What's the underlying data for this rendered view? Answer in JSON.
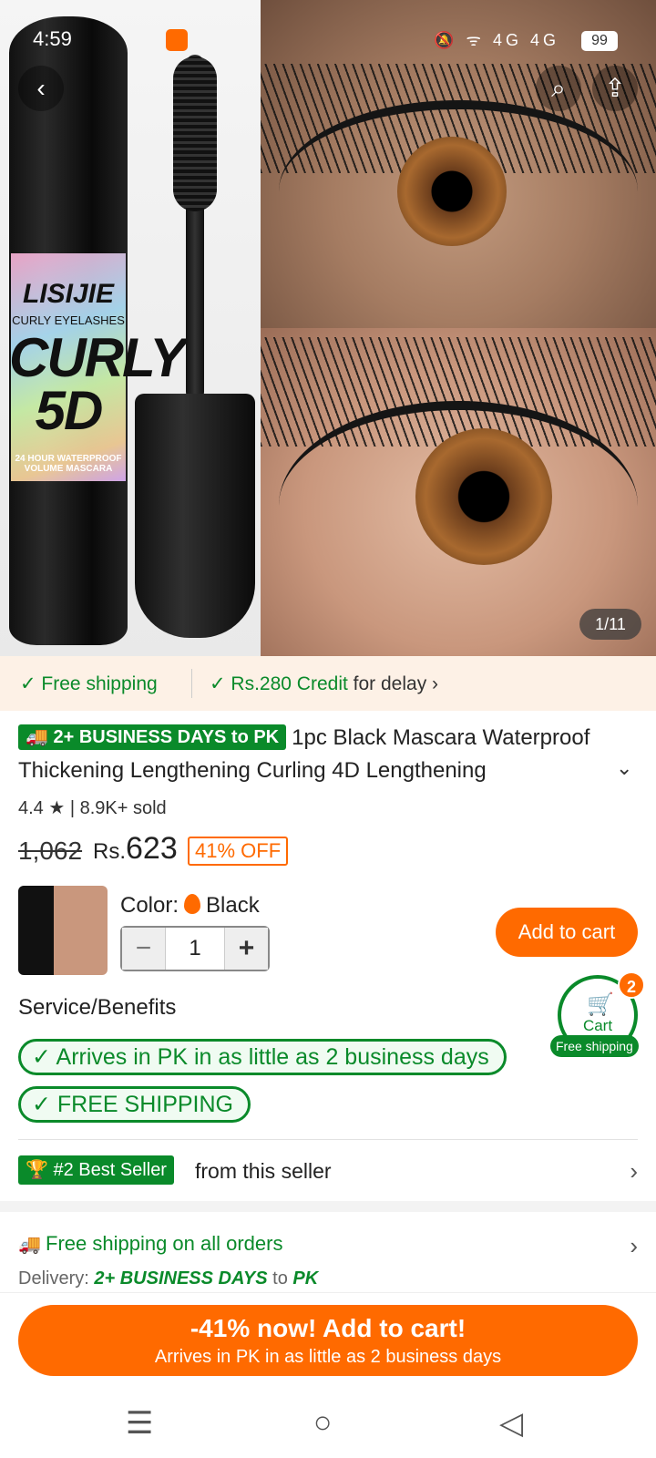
{
  "status_bar": {
    "time": "4:59",
    "icons": "🔕 ᯤ 4G 4G",
    "battery": "99"
  },
  "hero": {
    "tube_brand": "LISIJIE",
    "tube_sub": "CURLY EYELASHES",
    "tube_big": "CURLY 5D",
    "tube_small": "24 HOUR WATERPROOF VOLUME MASCARA",
    "pager": "1/11"
  },
  "nav": {
    "back": "‹",
    "search": "⌕",
    "share": "⇪"
  },
  "ship_strip": {
    "free_shipping": "✓ Free shipping",
    "credit": "✓ Rs.280 Credit",
    "credit_suffix": " for delay ›"
  },
  "product": {
    "delivery_badge": "🚚 2+ BUSINESS DAYS to PK",
    "title": "1pc Black Mascara Waterproof Thickening Lengthening Curling 4D Lengthening",
    "expand": "⌄",
    "rating": "4.4 ★ | 8.9K+ sold",
    "original_price": "1,062",
    "currency": "Rs.",
    "price": "623",
    "discount": "41% OFF"
  },
  "sku": {
    "color_label": "Color:",
    "color_value": "Black",
    "quantity": "1",
    "minus": "−",
    "plus": "+",
    "add_to_cart": "Add to cart"
  },
  "cart": {
    "label": "Cart",
    "count": "2",
    "free_shipping": "Free shipping",
    "icon": "🛒"
  },
  "services": {
    "title": "Service/Benefits",
    "items": [
      "✓ Arrives in PK in as little as 2 business days",
      "✓ FREE SHIPPING"
    ]
  },
  "best_seller": {
    "badge": "🏆 #2 Best Seller",
    "text": "from this seller",
    "chevron": "›"
  },
  "shipping_info": {
    "free_all": "Free shipping on all orders",
    "delivery_prefix": "Delivery: ",
    "delivery_days": "2+ BUSINESS DAYS",
    "delivery_mid": " to ",
    "delivery_country": "PK",
    "chevron": "›"
  },
  "cta": {
    "main": "-41% now! Add to cart!",
    "sub": "Arrives in PK in as little as 2 business days"
  },
  "system_nav": {
    "menu": "☰",
    "home": "○",
    "back": "◁"
  },
  "colors": {
    "accent": "#ff6a00",
    "green": "#0a8a2a"
  }
}
